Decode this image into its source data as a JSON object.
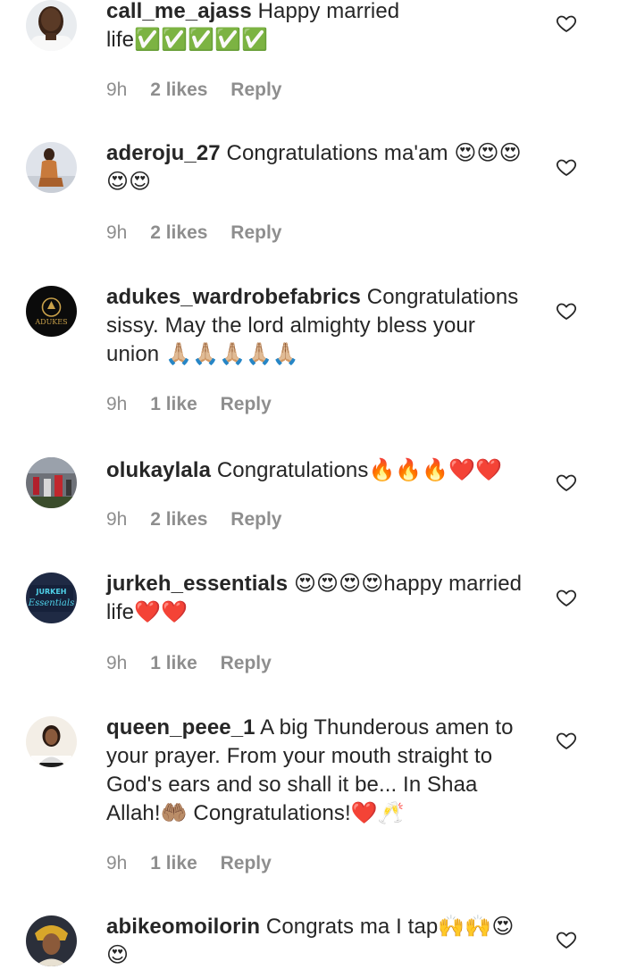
{
  "comments": [
    {
      "username": "call_me_ajass",
      "text": "Happy married life✅✅✅✅✅",
      "time": "9h",
      "likes": "2 likes",
      "reply": "Reply",
      "avatar_icon": "man-in-white-shirt-avatar"
    },
    {
      "username": "aderoju_27",
      "text": "Congratulations ma'am 😍😍😍😍😍",
      "time": "9h",
      "likes": "2 likes",
      "reply": "Reply",
      "avatar_icon": "woman-seated-avatar"
    },
    {
      "username": "adukes_wardrobefabrics",
      "text": "Congratulations sissy. May the lord almighty bless your union 🙏🏼🙏🏼🙏🏼🙏🏼🙏🏼",
      "time": "9h",
      "likes": "1 like",
      "reply": "Reply",
      "avatar_icon": "adukes-logo-avatar",
      "avatar_text": "ADUKES"
    },
    {
      "username": "olukaylala",
      "text": "Congratulations🔥🔥🔥❤️❤️",
      "time": "9h",
      "likes": "2 likes",
      "reply": "Reply",
      "avatar_icon": "stadium-crowd-avatar"
    },
    {
      "username": "jurkeh_essentials",
      "text": "😍😍😍😍happy married life❤️❤️",
      "time": "9h",
      "likes": "1 like",
      "reply": "Reply",
      "avatar_icon": "jurkeh-essentials-logo-avatar",
      "avatar_text_1": "JURKEH",
      "avatar_text_2": "Essentials"
    },
    {
      "username": "queen_peee_1",
      "text": "A big Thunderous amen to your prayer. From your mouth straight to God's ears and so shall it be... In Shaa Allah!🤲🏽 Congratulations!❤️🥂",
      "time": "9h",
      "likes": "1 like",
      "reply": "Reply",
      "avatar_icon": "woman-portrait-avatar"
    },
    {
      "username": "abikeomoilorin",
      "text": "Congrats ma I tap🙌🙌😍😍",
      "time": "",
      "likes": "",
      "reply": "",
      "avatar_icon": "woman-headwrap-avatar"
    }
  ],
  "colors": {
    "text": "#262626",
    "meta": "#8e8e8e",
    "heart_stroke": "#262626",
    "background": "#ffffff"
  },
  "icons": {
    "like": "heart-outline-icon"
  }
}
